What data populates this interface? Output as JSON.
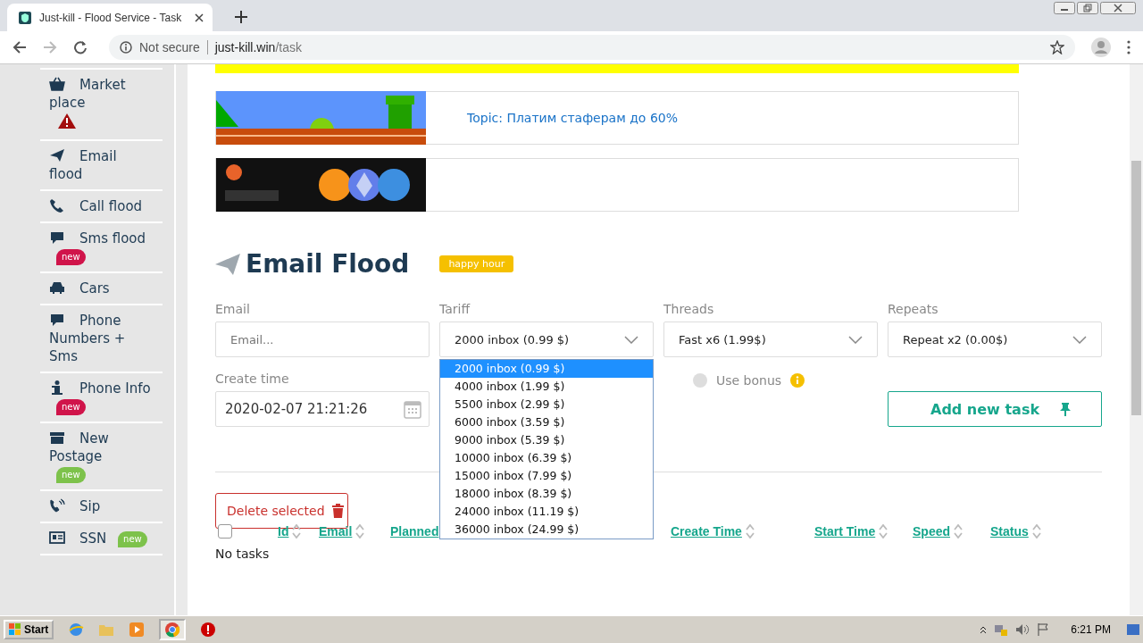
{
  "browser": {
    "tab_title": "Just-kill - Flood Service - Task",
    "security": "Not secure",
    "host": "just-kill.win",
    "path": "/task"
  },
  "sidebar": {
    "items": [
      {
        "label": "Market place",
        "warning": true
      },
      {
        "label": "Email flood",
        "warning": false
      },
      {
        "label": "Call flood",
        "warning": false
      },
      {
        "label": "Sms flood",
        "warning": false,
        "badge": {
          "text": "new",
          "color": "#d0144a"
        }
      },
      {
        "label": "Cars",
        "warning": false
      },
      {
        "label": "Phone Numbers + Sms",
        "warning": false
      },
      {
        "label": "Phone Info",
        "warning": false,
        "badge": {
          "text": "new",
          "color": "#d0144a"
        }
      },
      {
        "label": "New Postage",
        "warning": false,
        "badge": {
          "text": "new",
          "color": "#7dc24b"
        }
      },
      {
        "label": "Sip",
        "warning": false
      },
      {
        "label": "SSN",
        "warning": false,
        "badge": {
          "text": "new",
          "color": "#7dc24b"
        }
      }
    ]
  },
  "banners": [
    {
      "kind": "picture",
      "topic": "Topic: Платим стаферам до 60%"
    },
    {
      "kind": "picture"
    }
  ],
  "page": {
    "title": "Email Flood",
    "tag": "happy hour"
  },
  "form": {
    "email": {
      "label": "Email",
      "placeholder": "Email..."
    },
    "tariff": {
      "label": "Tariff",
      "value": "2000 inbox (0.99 $)",
      "expanded": true,
      "options": [
        {
          "label": "2000 inbox (0.99 $)",
          "selected": true
        },
        {
          "label": "4000 inbox (1.99 $)",
          "selected": false
        },
        {
          "label": "5500 inbox (2.99 $)",
          "selected": false
        },
        {
          "label": "6000 inbox (3.59 $)",
          "selected": false
        },
        {
          "label": "9000 inbox (5.39 $)",
          "selected": false
        },
        {
          "label": "10000 inbox (6.39 $)",
          "selected": false
        },
        {
          "label": "15000 inbox (7.99 $)",
          "selected": false
        },
        {
          "label": "18000 inbox (8.39 $)",
          "selected": false
        },
        {
          "label": "24000 inbox (11.19 $)",
          "selected": false
        },
        {
          "label": "36000 inbox (24.99 $)",
          "selected": false
        }
      ]
    },
    "threads": {
      "label": "Threads",
      "value": "Fast x6 (1.99$)"
    },
    "repeats": {
      "label": "Repeats",
      "value": "Repeat x2 (0.00$)"
    },
    "create_time": {
      "label": "Create time",
      "value": "2020-02-07 21:21:26"
    },
    "use_bonus": {
      "label": "Use bonus",
      "checked": false
    },
    "add_button": "Add new task"
  },
  "table": {
    "delete_button": "Delete selected",
    "select_all": false,
    "columns": [
      {
        "label": "Id"
      },
      {
        "label": "Email"
      },
      {
        "label": "Planned"
      },
      {
        "label": "Create Time"
      },
      {
        "label": "Start Time"
      },
      {
        "label": "Speed"
      },
      {
        "label": "Status"
      }
    ],
    "empty_text": "No tasks"
  },
  "taskbar": {
    "start": "Start",
    "clock": "6:21 PM"
  }
}
